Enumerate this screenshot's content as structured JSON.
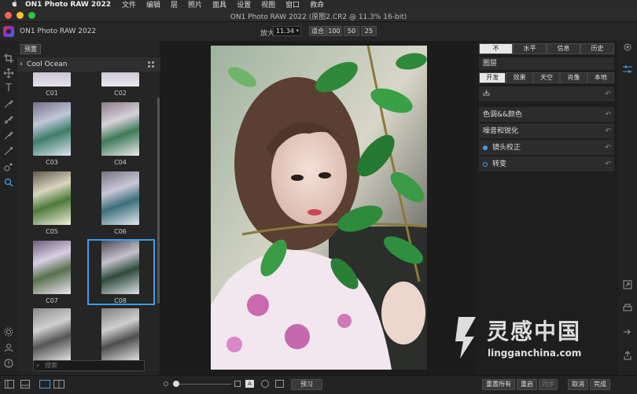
{
  "menubar": {
    "apple": "",
    "app": "ON1 Photo RAW 2022",
    "items": [
      "文件",
      "编辑",
      "层",
      "照片",
      "面具",
      "设置",
      "视图",
      "窗口",
      "救命"
    ]
  },
  "window": {
    "title": "ON1 Photo RAW 2022 (原图2.CR2 @ 11.3% 16-bit)"
  },
  "toolbar": {
    "app_name": "ON1 Photo RAW 2022",
    "zoom_label": "放大",
    "zoom_value": "11.34",
    "fit_label": "适合",
    "zoom_presets": [
      "100",
      "50",
      "25"
    ]
  },
  "browse": {
    "preset_tab": "预置",
    "category": "Cool Ocean",
    "thumbs": [
      {
        "label": "C01"
      },
      {
        "label": "C02"
      },
      {
        "label": "C03"
      },
      {
        "label": "C04"
      },
      {
        "label": "C05"
      },
      {
        "label": "C06"
      },
      {
        "label": "C07"
      },
      {
        "label": "C08"
      }
    ],
    "search_placeholder": "搜索"
  },
  "right_panel": {
    "view_tabs": [
      "不",
      "水平",
      "信息",
      "历史"
    ],
    "layers_title": "图层",
    "section_tabs": [
      "开发",
      "效果",
      "天空",
      "肖像",
      "本地"
    ],
    "adjustments": [
      "色调&&颜色",
      "噪音和锐化",
      "镜头校正",
      "转变"
    ]
  },
  "bottom": {
    "preview": "预习",
    "reset_all": "重置所有",
    "reset": "重启",
    "sync": "同步",
    "cancel": "取消",
    "done": "完成"
  },
  "watermark": {
    "brand": "灵感中国",
    "url": "lingganchina.com"
  },
  "colors": {
    "accent": "#3c9ee5",
    "active_dot": "#3c9ee5"
  }
}
